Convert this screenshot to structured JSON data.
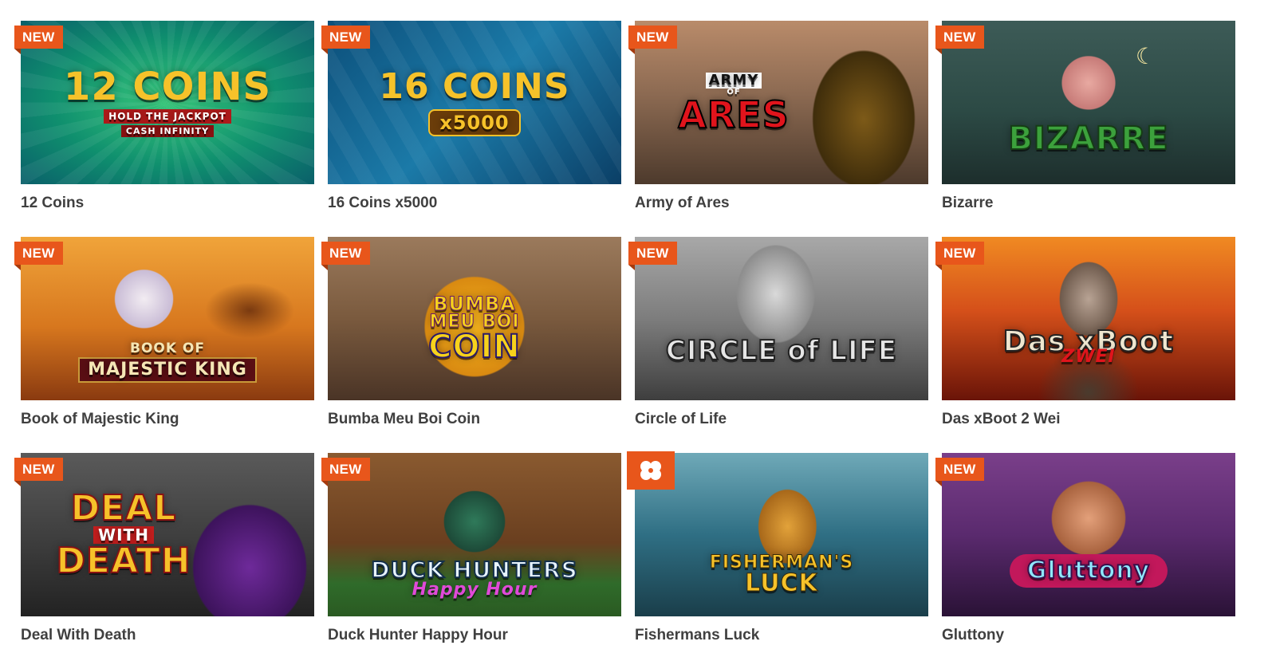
{
  "games": [
    {
      "title": "12 Coins",
      "badge": "NEW",
      "logo_line1": "12 COINS",
      "logo_line2": "HOLD THE JACKPOT",
      "logo_line3": "CASH INFINITY",
      "bg": "#0f8f6e"
    },
    {
      "title": "16 Coins x5000",
      "badge": "NEW",
      "logo_line1": "16 COINS",
      "logo_line2": "x5000",
      "logo_line3": "",
      "bg": "#145a8a"
    },
    {
      "title": "Army of Ares",
      "badge": "NEW",
      "logo_line1": "ARMY",
      "logo_line2": "OF",
      "logo_line3": "ARES",
      "bg": "#8c6a52"
    },
    {
      "title": "Bizarre",
      "badge": "NEW",
      "logo_line1": "BIZARRE",
      "logo_line2": "",
      "logo_line3": "",
      "bg": "#2c4a45"
    },
    {
      "title": "Book of Majestic King",
      "badge": "NEW",
      "logo_line1": "BOOK OF",
      "logo_line2": "MAJESTIC KING",
      "logo_line3": "",
      "bg": "#d7771e"
    },
    {
      "title": "Bumba Meu Boi Coin",
      "badge": "NEW",
      "logo_line1": "BUMBA",
      "logo_line2": "MEU BOI",
      "logo_line3": "COIN",
      "bg": "#7a5a3e"
    },
    {
      "title": "Circle of Life",
      "badge": "NEW",
      "logo_line1": "CIRCLE of LIFE",
      "logo_line2": "",
      "logo_line3": "",
      "bg": "#7d7d7d"
    },
    {
      "title": "Das xBoot 2 Wei",
      "badge": "NEW",
      "logo_line1": "Das xBoot",
      "logo_line2": "ZWEI",
      "logo_line3": "",
      "bg": "#c2330f"
    },
    {
      "title": "Deal With Death",
      "badge": "NEW",
      "logo_line1": "DEAL",
      "logo_line2": "WITH",
      "logo_line3": "DEATH",
      "bg": "#3a3a3a"
    },
    {
      "title": "Duck Hunter Happy Hour",
      "badge": "NEW",
      "logo_line1": "DUCK HUNTERS",
      "logo_line2": "Happy Hour",
      "logo_line3": "",
      "bg": "#6a3f1f"
    },
    {
      "title": "Fishermans Luck",
      "badge": "clover",
      "logo_line1": "FISHERMAN'S",
      "logo_line2": "LUCK",
      "logo_line3": "",
      "bg": "#2f6f84"
    },
    {
      "title": "Gluttony",
      "badge": "NEW",
      "logo_line1": "Gluttony",
      "logo_line2": "",
      "logo_line3": "",
      "bg": "#5a2a6e"
    }
  ],
  "colors": {
    "badge": "#e8561b",
    "title": "#404040"
  }
}
